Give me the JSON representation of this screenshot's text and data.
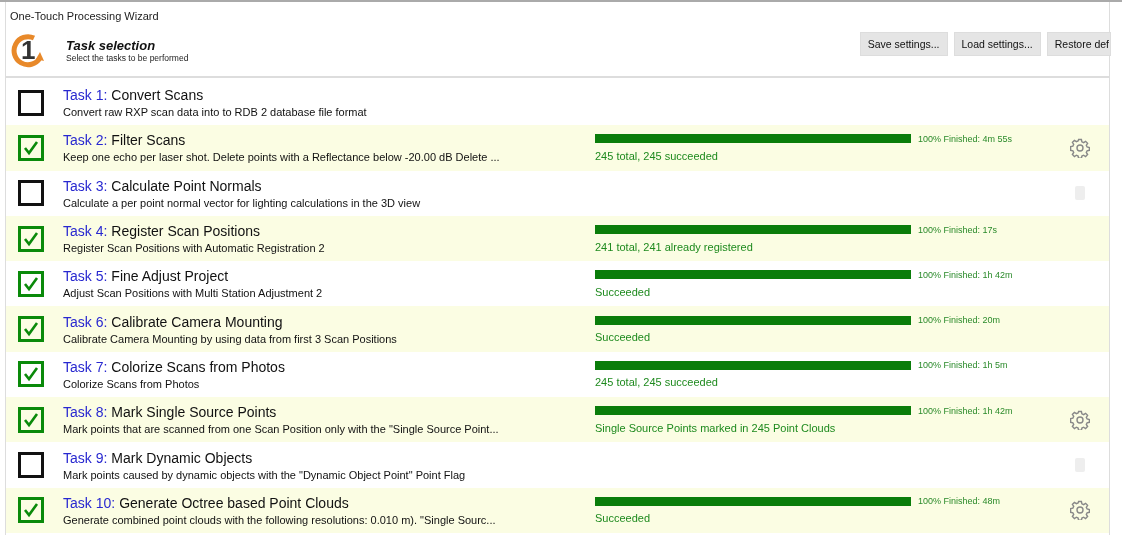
{
  "window": {
    "title": "One-Touch Processing Wizard"
  },
  "header": {
    "step_number": "1",
    "title": "Task selection",
    "subtitle": "Select the tasks to be performed"
  },
  "buttons": [
    "Save settings...",
    "Load settings...",
    "Restore def"
  ],
  "tasks": [
    {
      "number": "Task 1:",
      "name": "Convert Scans",
      "description": "Convert raw RXP scan data into to RDB 2 database file format",
      "checked": false
    },
    {
      "number": "Task 2:",
      "name": "Filter Scans",
      "description": "Keep one echo per laser shot. Delete points with a Reflectance below -20.00 dB Delete ...",
      "checked": true,
      "progress": {
        "level": 1,
        "label": "100% Finished: 4m 55s",
        "result": "245 total, 245 succeeded"
      },
      "settings": {
        "disabled": false
      }
    },
    {
      "number": "Task 3:",
      "name": "Calculate Point Normals",
      "description": "Calculate a per point normal vector for lighting calculations in the 3D view",
      "checked": false,
      "settings": {
        "disabled": true
      }
    },
    {
      "number": "Task 4:",
      "name": "Register Scan Positions",
      "description": "Register Scan Positions with Automatic Registration 2",
      "checked": true,
      "progress": {
        "level": 1,
        "label": "100% Finished: 17s",
        "result": "241 total, 241 already registered"
      }
    },
    {
      "number": "Task 5:",
      "name": "Fine Adjust Project",
      "description": "Adjust Scan Positions with Multi Station Adjustment 2",
      "checked": true,
      "progress": {
        "level": 1,
        "label": "100% Finished: 1h 42m",
        "result": "Succeeded"
      }
    },
    {
      "number": "Task 6:",
      "name": "Calibrate Camera Mounting",
      "description": "Calibrate Camera Mounting by using data from first 3 Scan Positions",
      "checked": true,
      "progress": {
        "level": 1,
        "label": "100% Finished: 20m",
        "result": "Succeeded"
      }
    },
    {
      "number": "Task 7:",
      "name": "Colorize Scans from Photos",
      "description": "Colorize Scans from Photos",
      "checked": true,
      "progress": {
        "level": 1,
        "label": "100% Finished: 1h 5m",
        "result": "245 total, 245 succeeded"
      }
    },
    {
      "number": "Task 8:",
      "name": "Mark Single Source Points",
      "description": "Mark points that are scanned from one Scan Position only with the \"Single Source Point...",
      "checked": true,
      "progress": {
        "level": 1,
        "label": "100% Finished: 1h 42m",
        "result": "Single Source Points marked in 245 Point Clouds"
      },
      "settings": {
        "disabled": false
      }
    },
    {
      "number": "Task 9:",
      "name": "Mark Dynamic Objects",
      "description": "Mark points caused by dynamic objects with the \"Dynamic Object Point\" Point Flag",
      "checked": false,
      "settings": {
        "disabled": true
      }
    },
    {
      "number": "Task 10:",
      "name": "Generate Octree based Point Clouds",
      "description": "Generate combined point clouds with the following resolutions: 0.010 m). \"Single Sourc...",
      "checked": true,
      "progress": {
        "level": 1,
        "label": "100% Finished: 48m",
        "result": "Succeeded"
      },
      "settings": {
        "disabled": false
      }
    }
  ]
}
